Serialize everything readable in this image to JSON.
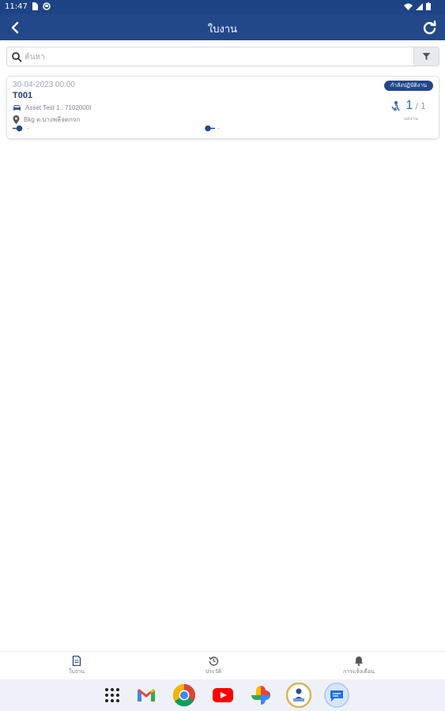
{
  "status_bar": {
    "time": "11:47",
    "left_icons": [
      "sim-icon",
      "shield-icon"
    ],
    "right_icons": [
      "wifi-icon",
      "signal-icon",
      "battery-icon"
    ]
  },
  "app_bar": {
    "title": "ใบงาน",
    "back_icon": "chevron-left-icon",
    "refresh_icon": "refresh-icon"
  },
  "search": {
    "placeholder": "ค้นหา",
    "value": "",
    "filter_icon": "filter-icon"
  },
  "work_orders": [
    {
      "date": "30-04-2023 00:00",
      "code": "T001",
      "status": "กำลังปฏิบัติงาน",
      "asset": "Asset Test 1 : 7102000I",
      "location": "Bkg ต.บางพลีจตกจก",
      "start": "-",
      "end": "-",
      "progress_done": "1",
      "progress_total": "1",
      "progress_separator": "/",
      "progress_label": "ผลงาน"
    }
  ],
  "bottom_nav": [
    {
      "label": "ใบงาน",
      "icon": "document-icon",
      "active": true
    },
    {
      "label": "ประวัติ",
      "icon": "history-icon",
      "active": false
    },
    {
      "label": "การแจ้งเตือน",
      "icon": "bell-icon",
      "active": false
    }
  ],
  "dock": {
    "apps": [
      "app-grid-icon",
      "gmail-icon",
      "chrome-icon",
      "youtube-icon",
      "photos-icon",
      "technician-app-icon",
      "messages-icon"
    ]
  },
  "colors": {
    "primary": "#23488a",
    "status_bar": "#1e4384",
    "accent_text": "#1e3f7c",
    "progress": "#2f63b0"
  }
}
